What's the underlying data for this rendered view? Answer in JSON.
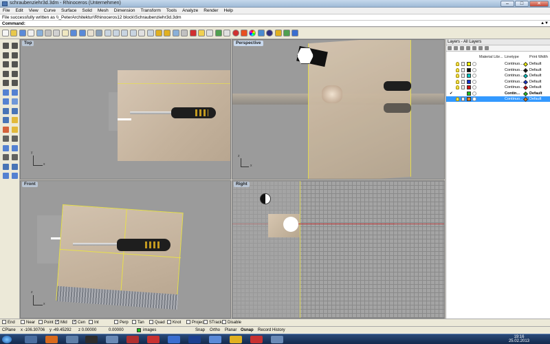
{
  "window": {
    "title": "schraubenziehr3d.3dm - Rhinoceros (Unternehmen)",
    "min": "–",
    "max": "□",
    "close": "✕"
  },
  "menu": [
    "File",
    "Edit",
    "View",
    "Curve",
    "Surface",
    "Solid",
    "Mesh",
    "Dimension",
    "Transform",
    "Tools",
    "Analyze",
    "Render",
    "Help"
  ],
  "status_message": "File successfully written as \\\\_PeterArchitektur\\Rhinoceros12 block\\Schraubenziehr3d.3dm",
  "command": {
    "label": "Command:",
    "scroll": "▲▼"
  },
  "toolbar_icons": [
    "new-icon",
    "open-icon",
    "save-icon",
    "print-icon",
    "import-icon",
    "cut-icon",
    "copy-icon",
    "paste-icon",
    "undo-icon",
    "redo-icon",
    "pan-icon",
    "rotate-view-icon",
    "zoom-dynamic-icon",
    "zoom-window-icon",
    "zoom-extents-icon",
    "zoom-selected-icon",
    "fourview-icon",
    "grid-icon",
    "set-view-icon",
    "set-cplane-icon",
    "hide-icon",
    "lock-icon",
    "car-icon",
    "light-icon",
    "layer-icon",
    "select-filter-icon",
    "properties-icon",
    "shade-icon",
    "render-icon",
    "color-wheel-icon",
    "material-icon",
    "sphere-icon",
    "tools-icon",
    "options-icon",
    "help-icon"
  ],
  "viewports": {
    "top": {
      "label": "Top"
    },
    "perspective": {
      "label": "Perspective"
    },
    "front": {
      "label": "Front"
    },
    "right": {
      "label": "Right"
    }
  },
  "axes": {
    "x": "x",
    "y": "y",
    "z": "z"
  },
  "layers": {
    "title": "Layers - All Layers",
    "columns": {
      "material": "Material Libr...",
      "linetype": "Linetype",
      "print_width": "Print Width"
    },
    "rows": [
      {
        "color": "#ffff00",
        "linetype": "Continuo...",
        "print_width": "Default",
        "diamond": "#ffff00",
        "current": false,
        "selected": false
      },
      {
        "color": "#111111",
        "linetype": "Continuo...",
        "print_width": "Default",
        "diamond": "#111111",
        "current": false,
        "selected": false
      },
      {
        "color": "#00c8c8",
        "linetype": "Continuo...",
        "print_width": "Default",
        "diamond": "#00c8c8",
        "current": false,
        "selected": false
      },
      {
        "color": "#1030d0",
        "linetype": "Continuo...",
        "print_width": "Default",
        "diamond": "#1030d0",
        "current": false,
        "selected": false
      },
      {
        "color": "#d01010",
        "linetype": "Continuo...",
        "print_width": "Default",
        "diamond": "#d01010",
        "current": false,
        "selected": false
      },
      {
        "color": "#20c020",
        "linetype": "Contin...",
        "print_width": "Default",
        "diamond": "#20c020",
        "current": true,
        "selected": false,
        "check": "✔"
      },
      {
        "color": "#e08020",
        "linetype": "Continuo...",
        "print_width": "Default",
        "diamond": "#e08020",
        "current": false,
        "selected": true
      }
    ]
  },
  "osnap": [
    {
      "label": "End",
      "on": false
    },
    {
      "label": "Near",
      "on": false
    },
    {
      "label": "Point",
      "on": false
    },
    {
      "label": "Mid",
      "on": true
    },
    {
      "label": "Cen",
      "on": true
    },
    {
      "label": "Int",
      "on": false
    },
    {
      "label": "Perp",
      "on": false
    },
    {
      "label": "Tan",
      "on": false
    },
    {
      "label": "Quad",
      "on": false
    },
    {
      "label": "Knot",
      "on": false
    },
    {
      "label": "Project",
      "on": false
    },
    {
      "label": "STrack",
      "on": false
    },
    {
      "label": "Disable",
      "on": false
    }
  ],
  "status": {
    "cplane": "CPlane",
    "x": "x -106.30706",
    "y": "y -49.45292",
    "z": "z 0.00000",
    "extra": "0.00000",
    "layer": "images",
    "snap": "Snap",
    "ortho": "Ortho",
    "planar": "Planar",
    "osnap": "Osnap",
    "record": "Record History"
  },
  "clock": {
    "time": "19:16",
    "date": "25.02.2013"
  },
  "colors": {
    "accent": "#3399ff",
    "viewport_bg": "#9b9b9b",
    "curve_yellow": "#e8e04a",
    "x_axis_red": "#c03030"
  }
}
